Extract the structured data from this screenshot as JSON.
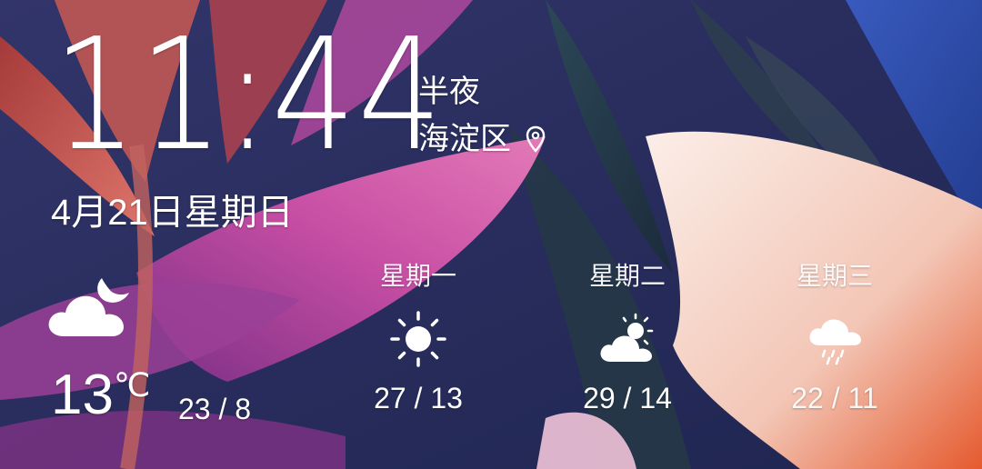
{
  "clock": {
    "hours": "11",
    "minutes": "44",
    "separator": ":"
  },
  "period": "半夜",
  "location": {
    "name": "海淀区",
    "icon": "location-pin-icon"
  },
  "date": "4月21日星期日",
  "today": {
    "icon": "cloudy-night-icon",
    "temperature": "13",
    "unit": "℃",
    "range": "23 / 8"
  },
  "forecast": [
    {
      "day": "星期一",
      "icon": "sunny-icon",
      "range": "27 / 13"
    },
    {
      "day": "星期二",
      "icon": "partly-cloudy-icon",
      "range": "29 / 14"
    },
    {
      "day": "星期三",
      "icon": "rain-icon",
      "range": "22 / 11"
    }
  ],
  "colors": {
    "background": "#2a2f5e",
    "text": "#ffffff",
    "leaf_pink": "#c04a9e",
    "leaf_red": "#c2473f",
    "petal_cream": "#f6d8cc",
    "petal_orange": "#e8643a"
  }
}
